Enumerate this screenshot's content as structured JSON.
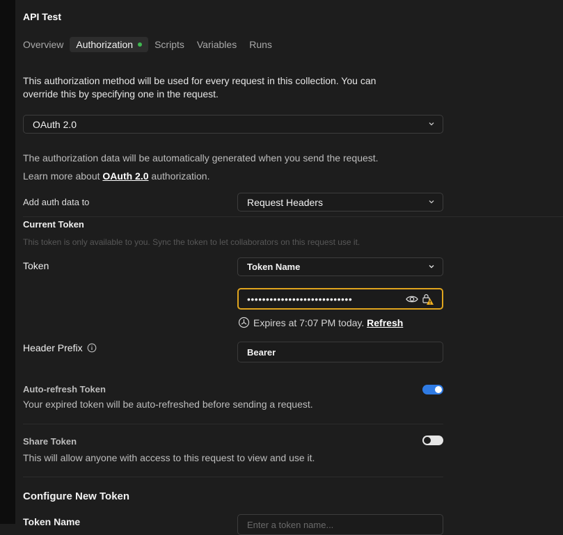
{
  "header": {
    "title": "API Test"
  },
  "tabs": [
    {
      "label": "Overview"
    },
    {
      "label": "Authorization"
    },
    {
      "label": "Scripts"
    },
    {
      "label": "Variables"
    },
    {
      "label": "Runs"
    }
  ],
  "intro": {
    "line1": "This authorization method will be used for every request in this collection. You can",
    "line2": "override this by specifying one in the request."
  },
  "auth_type": {
    "selected": "OAuth 2.0"
  },
  "auto_note": {
    "line1": "The authorization data will be automatically generated when you send the request.",
    "learn_prefix": "Learn more about ",
    "learn_link": "OAuth 2.0",
    "learn_suffix": " authorization."
  },
  "add_auth_data": {
    "label": "Add auth data to",
    "selected": "Request Headers"
  },
  "current_token": {
    "heading": "Current Token",
    "description": "This token is only available to you. Sync the token to let collaborators on this request use it.",
    "token_label": "Token",
    "token_name_selected": "Token Name",
    "token_masked": "••••••••••••••••••••••••••••",
    "expires_text": "Expires at 7:07 PM today.",
    "refresh_link": "Refresh"
  },
  "header_prefix": {
    "label": "Header Prefix",
    "value": "Bearer"
  },
  "auto_refresh": {
    "label": "Auto-refresh Token",
    "description": "Your expired token will be auto-refreshed before sending a request.",
    "enabled": true
  },
  "share_token": {
    "label": "Share Token",
    "description": "This will allow anyone with access to this request to view and use it.",
    "enabled": false
  },
  "configure": {
    "heading": "Configure New Token",
    "token_name_label": "Token Name",
    "token_name_placeholder": "Enter a token name..."
  },
  "colors": {
    "accent": "#2f7be4",
    "warning": "#e0a51e",
    "status_dot": "#3fb950",
    "background": "#1d1d1d"
  }
}
